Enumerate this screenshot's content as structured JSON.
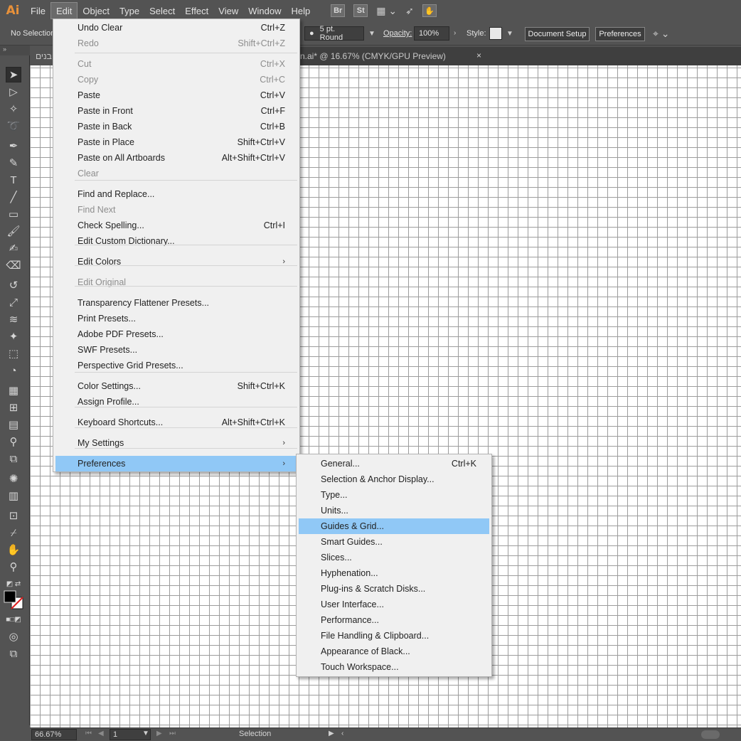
{
  "menubar": {
    "logo": "Ai",
    "items": [
      "File",
      "Edit",
      "Object",
      "Type",
      "Select",
      "Effect",
      "View",
      "Window",
      "Help"
    ],
    "bridge": "Br",
    "stock": "St"
  },
  "controlbar": {
    "selection": "No Selection",
    "brush": "5 pt. Round",
    "opacity_label": "Opacity:",
    "opacity_value": "100%",
    "style_label": "Style:",
    "document_setup": "Document Setup",
    "preferences": "Preferences"
  },
  "tabs": {
    "first_tab": "בנים",
    "active_tab": "n.ai* @ 16.67% (CMYK/GPU Preview)",
    "close": "×"
  },
  "edit_menu": {
    "items": [
      {
        "label": "Undo Clear",
        "shortcut": "Ctrl+Z",
        "disabled": false
      },
      {
        "label": "Redo",
        "shortcut": "Shift+Ctrl+Z",
        "disabled": true
      },
      {
        "label": "Cut",
        "shortcut": "Ctrl+X",
        "disabled": true
      },
      {
        "label": "Copy",
        "shortcut": "Ctrl+C",
        "disabled": true
      },
      {
        "label": "Paste",
        "shortcut": "Ctrl+V",
        "disabled": false
      },
      {
        "label": "Paste in Front",
        "shortcut": "Ctrl+F",
        "disabled": false
      },
      {
        "label": "Paste in Back",
        "shortcut": "Ctrl+B",
        "disabled": false
      },
      {
        "label": "Paste in Place",
        "shortcut": "Shift+Ctrl+V",
        "disabled": false
      },
      {
        "label": "Paste on All Artboards",
        "shortcut": "Alt+Shift+Ctrl+V",
        "disabled": false
      },
      {
        "label": "Clear",
        "shortcut": "",
        "disabled": true
      },
      {
        "label": "Find and Replace...",
        "shortcut": "",
        "disabled": false
      },
      {
        "label": "Find Next",
        "shortcut": "",
        "disabled": true
      },
      {
        "label": "Check Spelling...",
        "shortcut": "Ctrl+I",
        "disabled": false
      },
      {
        "label": "Edit Custom Dictionary...",
        "shortcut": "",
        "disabled": false
      },
      {
        "label": "Edit Colors",
        "shortcut": "",
        "disabled": false,
        "submenu": true
      },
      {
        "label": "Edit Original",
        "shortcut": "",
        "disabled": true
      },
      {
        "label": "Transparency Flattener Presets...",
        "shortcut": "",
        "disabled": false
      },
      {
        "label": "Print Presets...",
        "shortcut": "",
        "disabled": false
      },
      {
        "label": "Adobe PDF Presets...",
        "shortcut": "",
        "disabled": false
      },
      {
        "label": "SWF Presets...",
        "shortcut": "",
        "disabled": false
      },
      {
        "label": "Perspective Grid Presets...",
        "shortcut": "",
        "disabled": false
      },
      {
        "label": "Color Settings...",
        "shortcut": "Shift+Ctrl+K",
        "disabled": false
      },
      {
        "label": "Assign Profile...",
        "shortcut": "",
        "disabled": false
      },
      {
        "label": "Keyboard Shortcuts...",
        "shortcut": "Alt+Shift+Ctrl+K",
        "disabled": false
      },
      {
        "label": "My Settings",
        "shortcut": "",
        "disabled": false,
        "submenu": true
      },
      {
        "label": "Preferences",
        "shortcut": "",
        "disabled": false,
        "submenu": true,
        "highlighted": true
      }
    ],
    "arrow": "›"
  },
  "preferences_menu": {
    "items": [
      {
        "label": "General...",
        "shortcut": "Ctrl+K"
      },
      {
        "label": "Selection & Anchor Display...",
        "shortcut": ""
      },
      {
        "label": "Type...",
        "shortcut": ""
      },
      {
        "label": "Units...",
        "shortcut": ""
      },
      {
        "label": "Guides & Grid...",
        "shortcut": "",
        "highlighted": true
      },
      {
        "label": "Smart Guides...",
        "shortcut": ""
      },
      {
        "label": "Slices...",
        "shortcut": ""
      },
      {
        "label": "Hyphenation...",
        "shortcut": ""
      },
      {
        "label": "Plug-ins & Scratch Disks...",
        "shortcut": ""
      },
      {
        "label": "User Interface...",
        "shortcut": ""
      },
      {
        "label": "Performance...",
        "shortcut": ""
      },
      {
        "label": "File Handling & Clipboard...",
        "shortcut": ""
      },
      {
        "label": "Appearance of Black...",
        "shortcut": ""
      },
      {
        "label": "Touch Workspace...",
        "shortcut": ""
      }
    ]
  },
  "statusbar": {
    "zoom": "66.67%",
    "page": "1",
    "tool": "Selection"
  },
  "colors": {
    "highlight": "#90c8f6",
    "ai_orange": "#e8913a"
  }
}
